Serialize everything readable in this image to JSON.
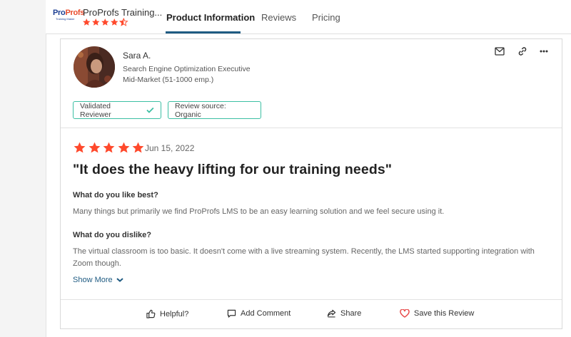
{
  "header": {
    "product_name": "ProProfs Training...",
    "rating_stars": 4.5,
    "logo_text": "ProProfs",
    "logo_subtext": "Training Maker",
    "tabs": [
      {
        "label": "Product Information",
        "active": true
      },
      {
        "label": "Reviews",
        "active": false
      },
      {
        "label": "Pricing",
        "active": false
      }
    ]
  },
  "review": {
    "reviewer": {
      "name": "Sara A.",
      "title": "Search Engine Optimization Executive",
      "segment": "Mid-Market (51-1000 emp.)"
    },
    "badges": {
      "validated": "Validated Reviewer",
      "source": "Review source: Organic"
    },
    "rating": 5,
    "date": "Jun 15, 2022",
    "title": "\"It does the heavy lifting for our training needs\"",
    "questions": [
      {
        "label": "What do you like best?",
        "answer": "Many things but primarily we find ProProfs LMS to be an easy learning solution and we feel secure using it."
      },
      {
        "label": "What do you dislike?",
        "answer": "The virtual classroom is too basic. It doesn't come with a live streaming system. Recently, the LMS started supporting integration with Zoom though."
      }
    ],
    "show_more": "Show More",
    "actions": {
      "helpful": "Helpful?",
      "add_comment": "Add Comment",
      "share": "Share",
      "save": "Save this Review"
    }
  },
  "colors": {
    "star": "#ff492c",
    "accent_blue": "#1f5b82",
    "badge_border": "#3cbfa3",
    "save_heart": "#e84b4b"
  },
  "icons": [
    "envelope-icon",
    "link-icon",
    "more-icon",
    "check-icon",
    "thumbs-up-icon",
    "comment-icon",
    "share-icon",
    "heart-icon",
    "chevron-down-icon"
  ]
}
